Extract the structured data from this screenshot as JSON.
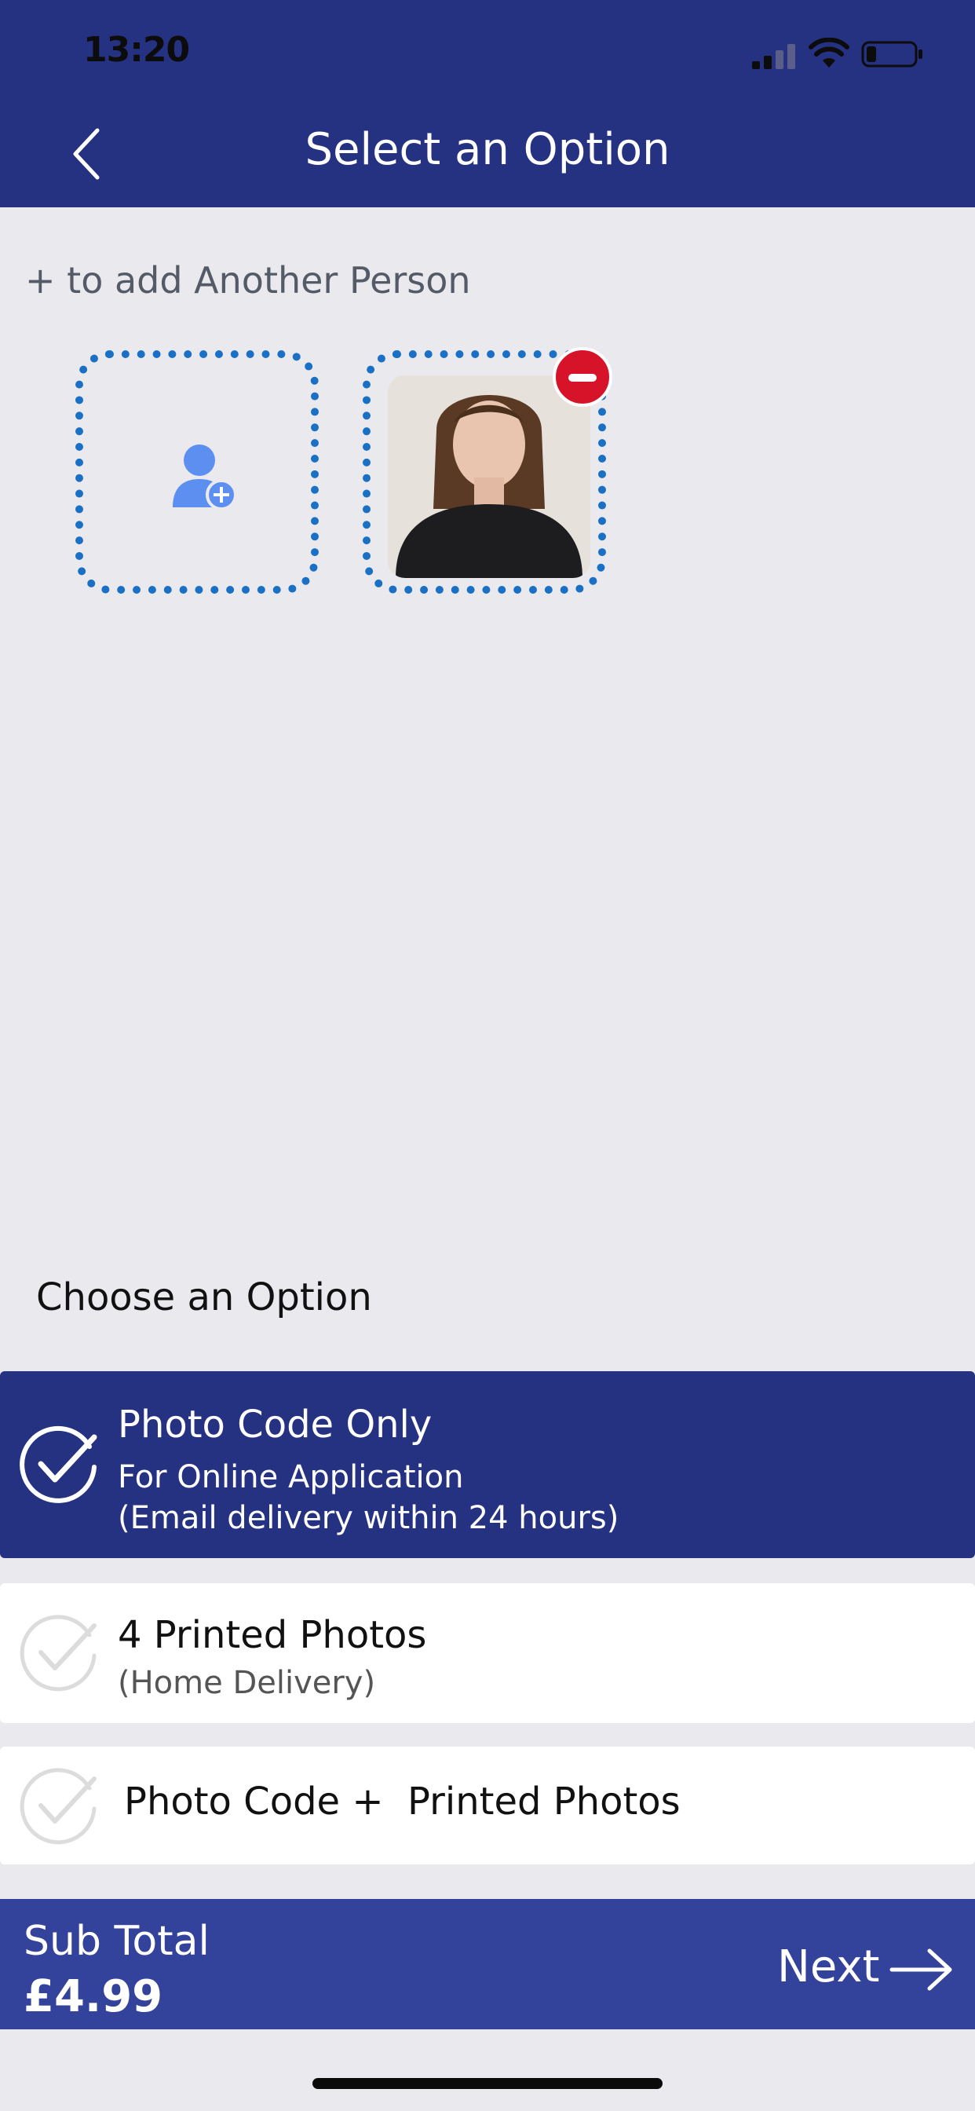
{
  "status_bar": {
    "time": "13:20"
  },
  "header": {
    "title": "Select an Option"
  },
  "people": {
    "hint": "+ to add Another Person"
  },
  "options_section": {
    "heading": "Choose an Option",
    "options": [
      {
        "title": "Photo Code Only",
        "subtitle_line1": "For Online Application",
        "subtitle_line2": "(Email delivery within 24 hours)",
        "selected": true
      },
      {
        "title": "4 Printed Photos",
        "subtitle_line1": "(Home Delivery)",
        "selected": false
      },
      {
        "title": "Photo Code +  Printed Photos",
        "selected": false
      }
    ]
  },
  "footer": {
    "subtotal_label": "Sub Total",
    "subtotal_amount": "£4.99",
    "next_label": "Next"
  },
  "colors": {
    "primary": "#253181",
    "footer": "#33429a",
    "accent_blue": "#1a70c4",
    "remove_red": "#d7132a",
    "background": "#e9e9ee"
  }
}
